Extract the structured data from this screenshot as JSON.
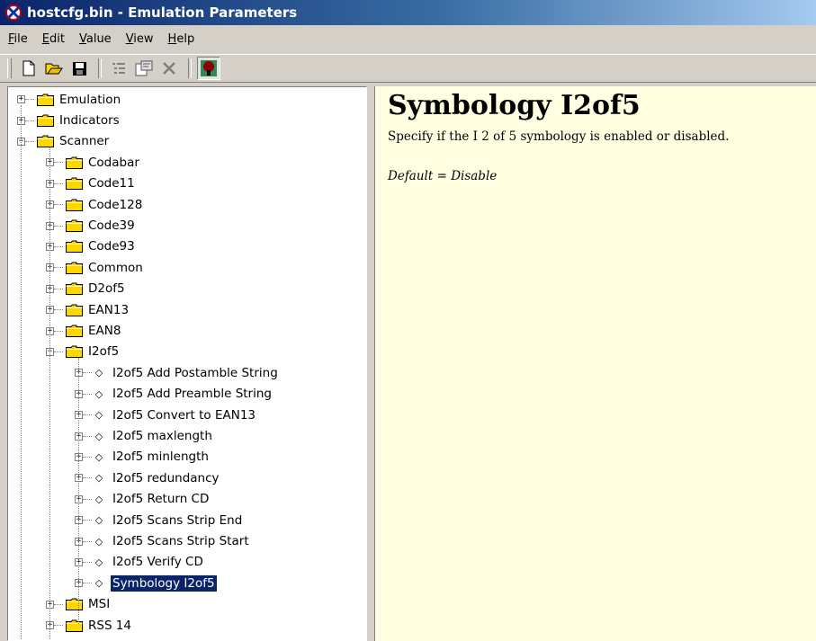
{
  "window": {
    "title": "hostcfg.bin - Emulation Parameters"
  },
  "menu": [
    {
      "label": "File",
      "ul": "F",
      "rest": "ile"
    },
    {
      "label": "Edit",
      "ul": "E",
      "rest": "dit"
    },
    {
      "label": "Value",
      "ul": "V",
      "rest": "alue"
    },
    {
      "label": "View",
      "ul": "V",
      "rest": "iew"
    },
    {
      "label": "Help",
      "ul": "H",
      "rest": "elp"
    }
  ],
  "toolbar": {
    "buttons": [
      "new-icon",
      "open-icon",
      "save-icon",
      "list-icon",
      "properties-icon",
      "delete-icon",
      "tree-icon"
    ]
  },
  "tree": {
    "top_level": [
      {
        "label": "Emulation",
        "expander": "+",
        "type": "folder"
      },
      {
        "label": "Indicators",
        "expander": "+",
        "type": "folder"
      },
      {
        "label": "Scanner",
        "expander": "-",
        "type": "folder"
      }
    ],
    "scanner_children": [
      {
        "label": "Codabar",
        "expander": "+",
        "type": "folder"
      },
      {
        "label": "Code11",
        "expander": "+",
        "type": "folder"
      },
      {
        "label": "Code128",
        "expander": "+",
        "type": "folder"
      },
      {
        "label": "Code39",
        "expander": "+",
        "type": "folder"
      },
      {
        "label": "Code93",
        "expander": "+",
        "type": "folder"
      },
      {
        "label": "Common",
        "expander": "+",
        "type": "folder"
      },
      {
        "label": "D2of5",
        "expander": "+",
        "type": "folder"
      },
      {
        "label": "EAN13",
        "expander": "+",
        "type": "folder"
      },
      {
        "label": "EAN8",
        "expander": "+",
        "type": "folder"
      },
      {
        "label": "I2of5",
        "expander": "-",
        "type": "folder"
      }
    ],
    "i2of5_children": [
      {
        "label": "I2of5 Add Postamble String"
      },
      {
        "label": "I2of5 Add Preamble String"
      },
      {
        "label": "I2of5 Convert to EAN13"
      },
      {
        "label": "I2of5 maxlength"
      },
      {
        "label": "I2of5 minlength"
      },
      {
        "label": "I2of5 redundancy"
      },
      {
        "label": "I2of5 Return CD"
      },
      {
        "label": "I2of5 Scans Strip End"
      },
      {
        "label": "I2of5 Scans Strip Start"
      },
      {
        "label": "I2of5 Verify CD"
      },
      {
        "label": "Symbology I2of5",
        "selected": true
      }
    ],
    "after": [
      {
        "label": "MSI",
        "expander": "+",
        "type": "folder"
      },
      {
        "label": "RSS 14",
        "expander": "+",
        "type": "folder"
      }
    ]
  },
  "help": {
    "title": "Symbology I2of5",
    "description": "Specify if the I 2 of 5 symbology is enabled or disabled.",
    "default": "Default = Disable"
  },
  "colors": {
    "selection": "#0a246a",
    "help_background": "#ffffe1",
    "folder": "#ffd700"
  }
}
